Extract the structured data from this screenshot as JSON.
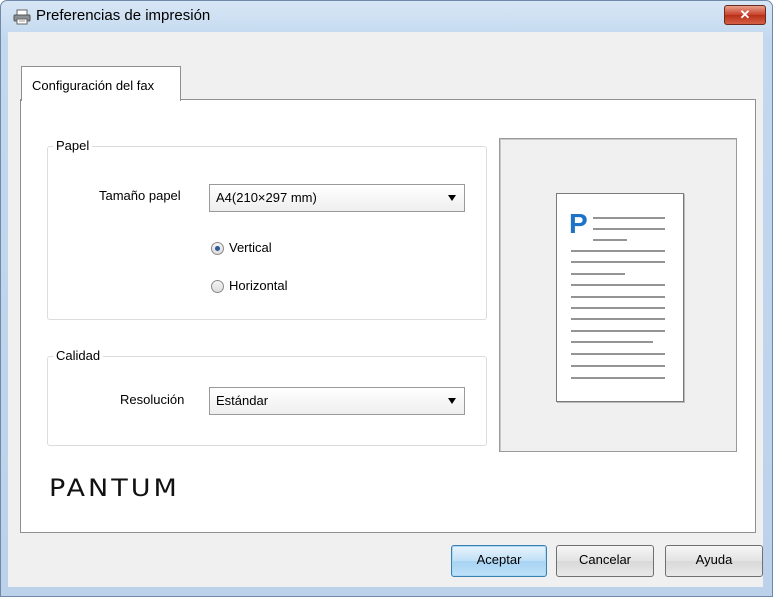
{
  "window": {
    "title": "Preferencias de impresión",
    "close_label": "✕",
    "icon": "printer-icon"
  },
  "tabs": [
    {
      "label": "Configuración del fax",
      "selected": true
    }
  ],
  "paper_group": {
    "legend": "Papel",
    "size_label": "Tamaño papel",
    "size_value": "A4(210×297 mm)",
    "orientation_options": [
      {
        "label": "Vertical",
        "checked": true
      },
      {
        "label": "Horizontal",
        "checked": false
      }
    ]
  },
  "quality_group": {
    "legend": "Calidad",
    "resolution_label": "Resolución",
    "resolution_value": "Estándar"
  },
  "preview": {
    "page_letter": "P",
    "accent_color": "#1e73c8"
  },
  "brand": {
    "logo_text": "PANTUM"
  },
  "buttons": {
    "ok": "Aceptar",
    "cancel": "Cancelar",
    "help": "Ayuda"
  }
}
